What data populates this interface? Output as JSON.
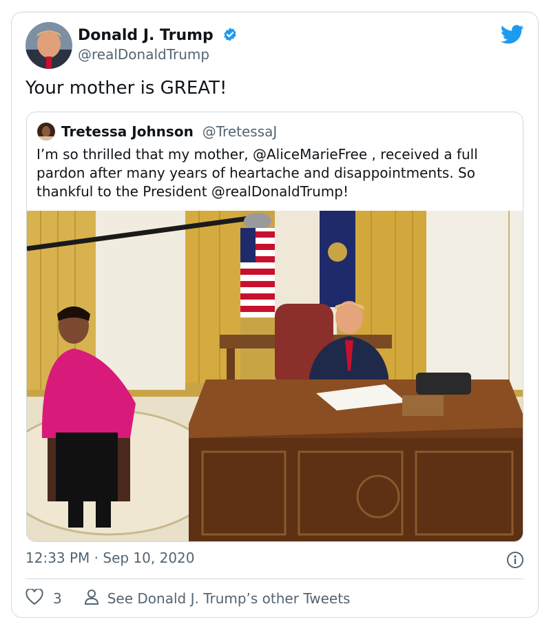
{
  "author": {
    "name": "Donald J. Trump",
    "handle": "@realDonaldTrump"
  },
  "tweet": {
    "text": "Your mother is GREAT!",
    "timestamp": "12:33 PM · Sep 10, 2020",
    "likes": "3",
    "other_tweets_link": "See Donald J. Trump’s other Tweets"
  },
  "quoted": {
    "name": "Tretessa Johnson",
    "handle": "@TretessaJ",
    "text": "I’m so thrilled that my mother, @AliceMarieFree , received a full pardon after many years of heartache and disappointments. So thankful to the President @realDonaldTrump!"
  },
  "icons": {
    "verified": "verified-badge-icon",
    "brand": "twitter-bird-icon",
    "info": "info-icon",
    "like": "heart-icon",
    "profile": "person-icon"
  },
  "colors": {
    "brand_blue": "#1d9bf0",
    "text": "#0f1419",
    "muted": "#536471",
    "border": "#cfd9de"
  }
}
